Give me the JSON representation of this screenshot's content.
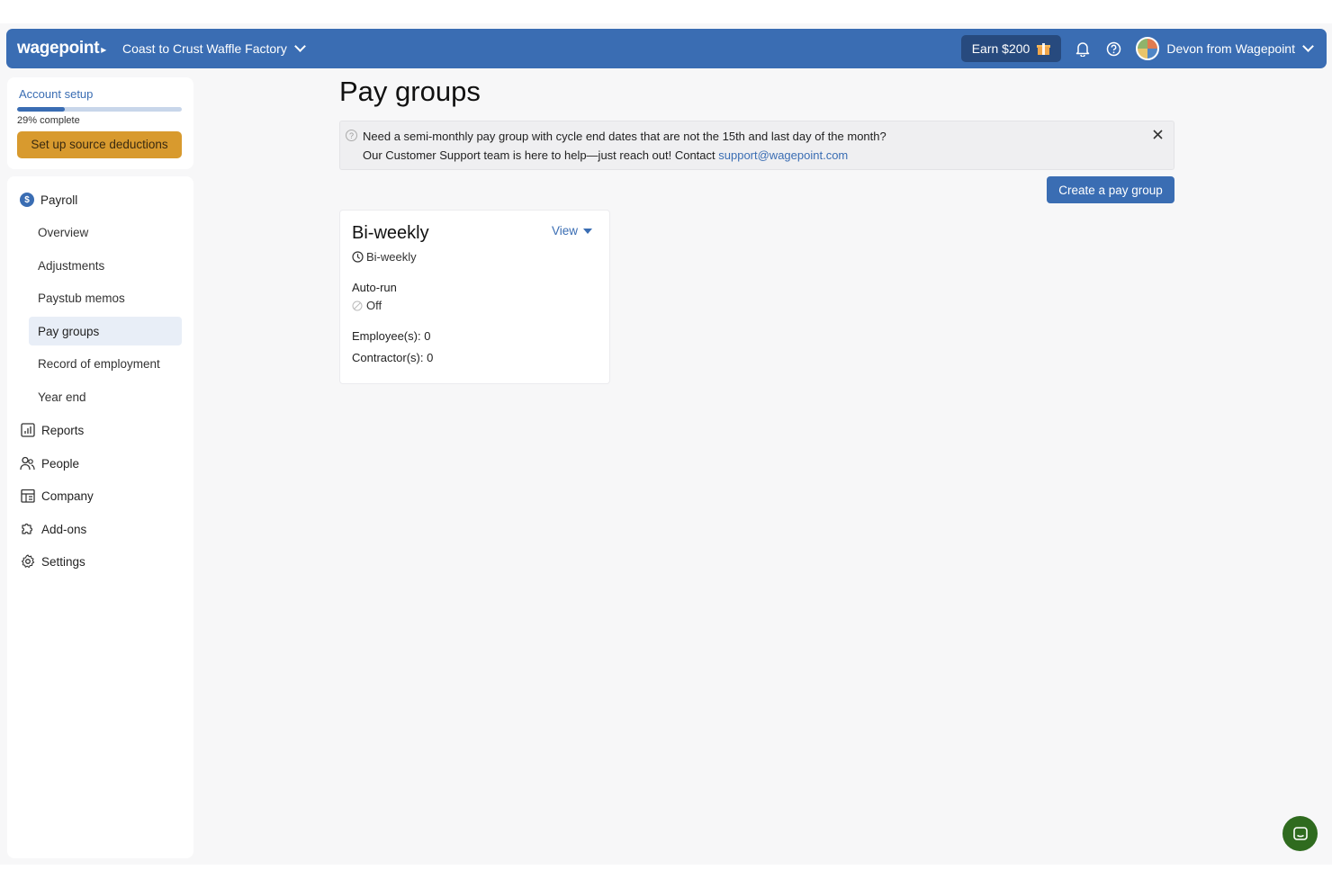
{
  "header": {
    "logo": "wagepoint",
    "company": "Coast to Crust Waffle Factory",
    "earn_label": "Earn $200",
    "user": "Devon from Wagepoint"
  },
  "setup": {
    "title": "Account setup",
    "progress_percent": 29,
    "progress_label": "29% complete",
    "button": "Set up source deductions"
  },
  "nav": {
    "payroll": "Payroll",
    "sub": [
      "Overview",
      "Adjustments",
      "Paystub memos",
      "Pay groups",
      "Record of employment",
      "Year end"
    ],
    "active_sub": "Pay groups",
    "reports": "Reports",
    "people": "People",
    "company": "Company",
    "addons": "Add-ons",
    "settings": "Settings"
  },
  "main": {
    "title": "Pay groups",
    "banner": {
      "line1": "Need a semi-monthly pay group with cycle end dates that are not the 15th and last day of the month?",
      "line2": "Our Customer Support team is here to help—just reach out! Contact ",
      "email": "support@wagepoint.com"
    },
    "create_button": "Create a pay group",
    "pay_group": {
      "name": "Bi-weekly",
      "view_label": "View",
      "frequency": "Bi-weekly",
      "auto_run_label": "Auto-run",
      "auto_run_value": "Off",
      "employees": "Employee(s): 0",
      "contractors": "Contractor(s): 0"
    }
  },
  "colors": {
    "brand": "#3a6db3",
    "setup_button": "#d89a2e",
    "chat": "#2f6b1f"
  }
}
